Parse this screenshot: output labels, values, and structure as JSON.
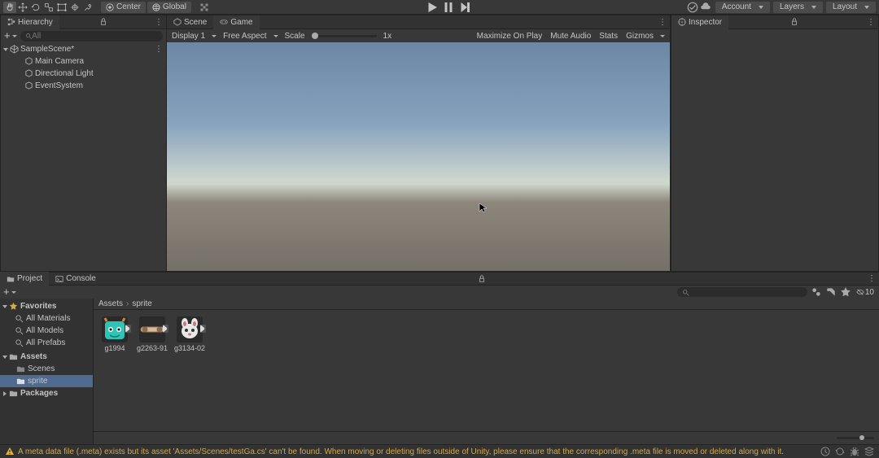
{
  "toolbar": {
    "pivot_label": "Center",
    "handle_label": "Global",
    "account_label": "Account",
    "layers_label": "Layers",
    "layout_label": "Layout"
  },
  "hierarchy": {
    "title": "Hierarchy",
    "search_placeholder": "All",
    "scene_name": "SampleScene*",
    "objects": [
      "Main Camera",
      "Directional Light",
      "EventSystem"
    ]
  },
  "scene": {
    "tab_scene": "Scene",
    "tab_game": "Game",
    "display_label": "Display 1",
    "aspect_label": "Free Aspect",
    "scale_label": "Scale",
    "scale_value": "1x",
    "max_label": "Maximize On Play",
    "mute_label": "Mute Audio",
    "stats_label": "Stats",
    "gizmos_label": "Gizmos"
  },
  "inspector": {
    "title": "Inspector"
  },
  "project": {
    "tab_project": "Project",
    "tab_console": "Console",
    "favorites_label": "Favorites",
    "fav_items": [
      "All Materials",
      "All Models",
      "All Prefabs"
    ],
    "assets_label": "Assets",
    "folders": [
      "Scenes",
      "sprite"
    ],
    "packages_label": "Packages",
    "breadcrumb": [
      "Assets",
      "sprite"
    ],
    "assets": [
      "g1994",
      "g2263-91",
      "g3134-02"
    ],
    "hidden_count": "10"
  },
  "status": {
    "warning": "A meta data file (.meta) exists but its asset 'Assets/Scenes/testGa.cs' can't be found. When moving or deleting files outside of Unity, please ensure that the corresponding .meta file is moved or deleted along with it."
  }
}
